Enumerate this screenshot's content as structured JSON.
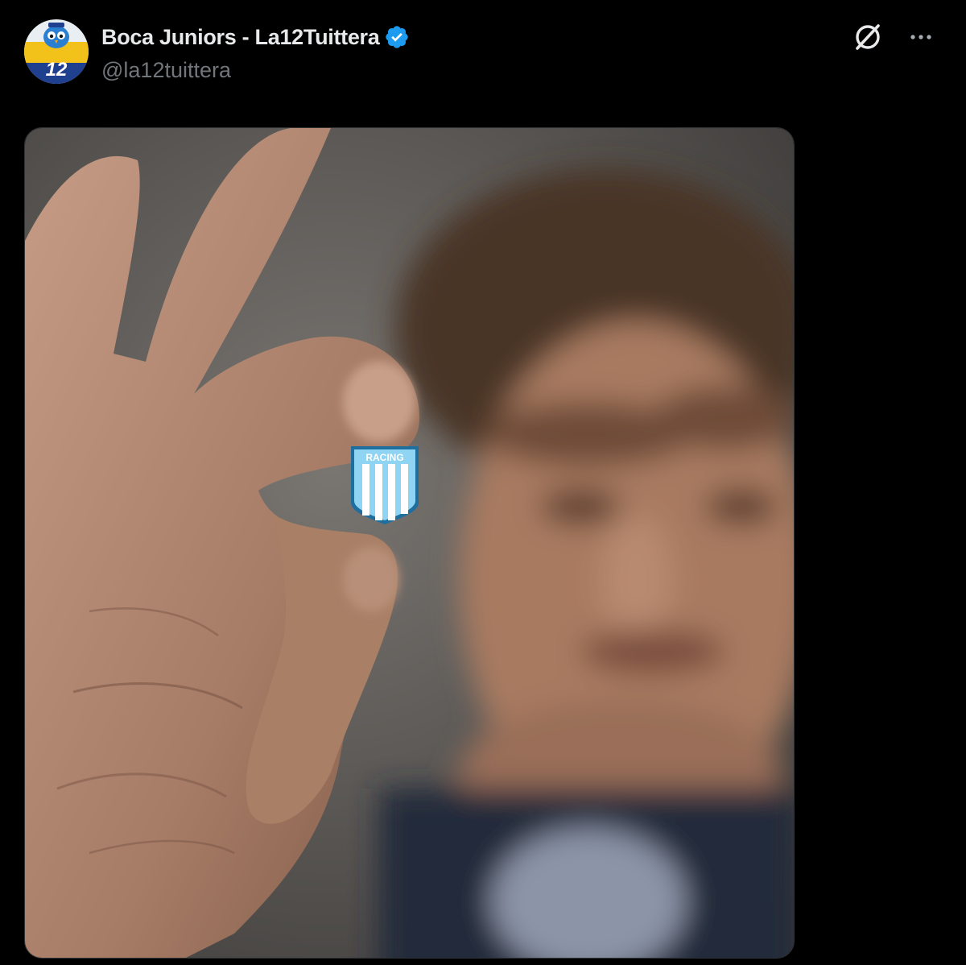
{
  "tweet": {
    "display_name": "Boca Juniors - La12Tuittera",
    "handle": "@la12tuittera",
    "verified": true,
    "avatar_number": "12",
    "media": {
      "badge_text": "RACING"
    },
    "icons": {
      "verified": "verified-badge-icon",
      "grok": "grok-icon",
      "more": "more-options-icon"
    }
  },
  "colors": {
    "background": "#000000",
    "primary_text": "#e7e9ea",
    "secondary_text": "#71767b",
    "verified_blue": "#1d9bf0",
    "badge_sky": "#75c8ec"
  }
}
